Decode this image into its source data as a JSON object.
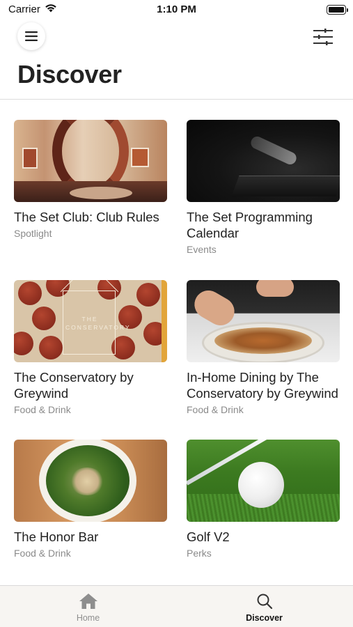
{
  "status_bar": {
    "carrier": "Carrier",
    "time": "1:10 PM"
  },
  "header": {
    "title": "Discover",
    "menu_icon": "hamburger-menu-icon",
    "filter_icon": "filter-sliders-icon"
  },
  "cards": [
    {
      "title": "The Set Club: Club Rules",
      "category": "Spotlight",
      "image": "spiral-staircase-lobby"
    },
    {
      "title": "The Set Programming Calendar",
      "category": "Events",
      "image": "dj-turntables-dark"
    },
    {
      "title": "The Conservatory by Greywind",
      "category": "Food & Drink",
      "image": "conservatory-logo-pattern"
    },
    {
      "title": "In-Home Dining by The Conservatory by Greywind",
      "category": "Food & Drink",
      "image": "chef-plating-dish"
    },
    {
      "title": "The Honor Bar",
      "category": "Food & Drink",
      "image": "salad-bowl"
    },
    {
      "title": "Golf V2",
      "category": "Perks",
      "image": "golf-ball-on-grass"
    }
  ],
  "image_text": {
    "conservatory_logo": "THE CONSERVATORY"
  },
  "tab_bar": {
    "tabs": [
      {
        "label": "Home",
        "icon": "home-icon",
        "active": false
      },
      {
        "label": "Discover",
        "icon": "search-icon",
        "active": true
      }
    ]
  },
  "colors": {
    "active_tab": "#111111",
    "inactive_tab": "#8e8e8e",
    "category_text": "#8a8a8a"
  }
}
